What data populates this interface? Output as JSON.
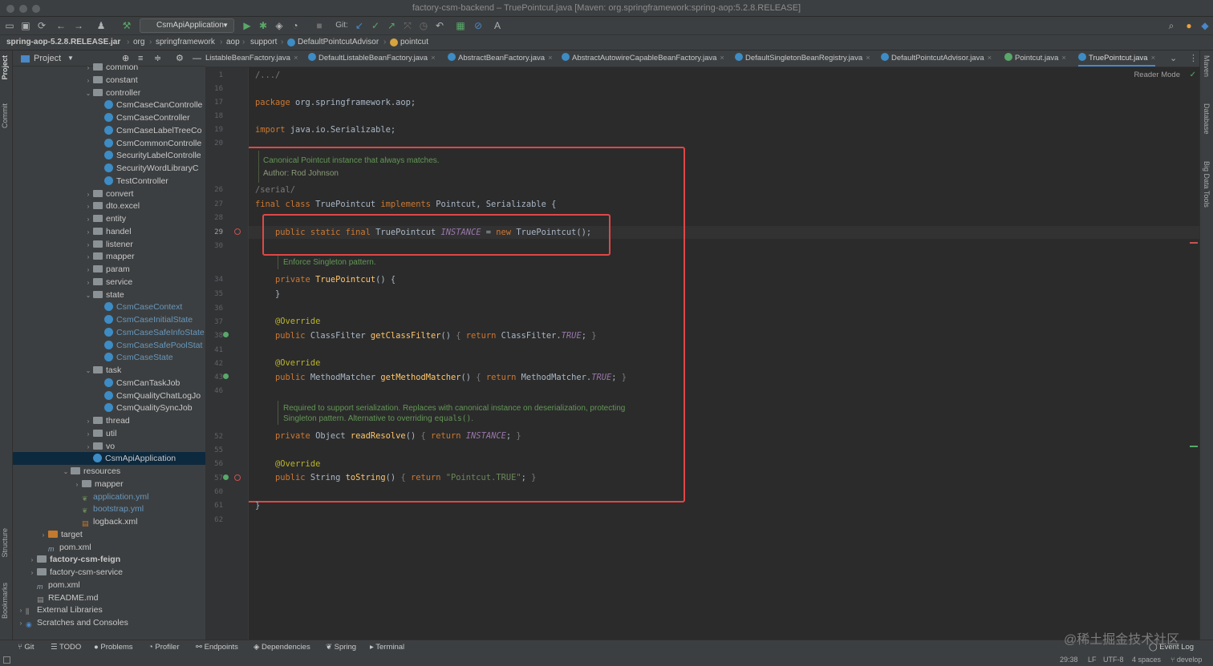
{
  "window": {
    "title": "factory-csm-backend – TruePointcut.java [Maven: org.springframework:spring-aop:5.2.8.RELEASE]"
  },
  "toolbar": {
    "run_config": "CsmApiApplication",
    "git_label": "Git:"
  },
  "breadcrumb": [
    "spring-aop-5.2.8.RELEASE.jar",
    "org",
    "springframework",
    "aop",
    "support",
    "DefaultPointcutAdvisor",
    "pointcut"
  ],
  "left_strip": [
    "Project",
    "Commit",
    "Structure",
    "Bookmarks"
  ],
  "right_strip": [
    "Maven",
    "Database",
    "Big Data Tools"
  ],
  "project_panel": {
    "title": "Project",
    "tree": [
      {
        "label": "common",
        "type": "folder",
        "depth": 6,
        "arrow": "›"
      },
      {
        "label": "constant",
        "type": "folder",
        "depth": 6,
        "arrow": "›"
      },
      {
        "label": "controller",
        "type": "folder",
        "depth": 6,
        "arrow": "⌄"
      },
      {
        "label": "CsmCaseCanControlle",
        "type": "class",
        "depth": 7
      },
      {
        "label": "CsmCaseController",
        "type": "class",
        "depth": 7
      },
      {
        "label": "CsmCaseLabelTreeCo",
        "type": "class",
        "depth": 7
      },
      {
        "label": "CsmCommonControlle",
        "type": "class",
        "depth": 7
      },
      {
        "label": "SecurityLabelControlle",
        "type": "class",
        "depth": 7
      },
      {
        "label": "SecurityWordLibraryC",
        "type": "class",
        "depth": 7
      },
      {
        "label": "TestController",
        "type": "class",
        "depth": 7
      },
      {
        "label": "convert",
        "type": "folder",
        "depth": 6,
        "arrow": "›"
      },
      {
        "label": "dto.excel",
        "type": "folder",
        "depth": 6,
        "arrow": "›"
      },
      {
        "label": "entity",
        "type": "folder",
        "depth": 6,
        "arrow": "›"
      },
      {
        "label": "handel",
        "type": "folder",
        "depth": 6,
        "arrow": "›"
      },
      {
        "label": "listener",
        "type": "folder",
        "depth": 6,
        "arrow": "›"
      },
      {
        "label": "mapper",
        "type": "folder",
        "depth": 6,
        "arrow": "›"
      },
      {
        "label": "param",
        "type": "folder",
        "depth": 6,
        "arrow": "›"
      },
      {
        "label": "service",
        "type": "folder",
        "depth": 6,
        "arrow": "›"
      },
      {
        "label": "state",
        "type": "folder",
        "depth": 6,
        "arrow": "⌄"
      },
      {
        "label": "CsmCaseContext",
        "type": "class-blue",
        "depth": 7
      },
      {
        "label": "CsmCaseInitialState",
        "type": "class-blue",
        "depth": 7
      },
      {
        "label": "CsmCaseSafeInfoState",
        "type": "class-blue",
        "depth": 7
      },
      {
        "label": "CsmCaseSafePoolStat",
        "type": "class-blue",
        "depth": 7
      },
      {
        "label": "CsmCaseState",
        "type": "class-blue",
        "depth": 7
      },
      {
        "label": "task",
        "type": "folder",
        "depth": 6,
        "arrow": "⌄"
      },
      {
        "label": "CsmCanTaskJob",
        "type": "class",
        "depth": 7
      },
      {
        "label": "CsmQualityChatLogJo",
        "type": "class",
        "depth": 7
      },
      {
        "label": "CsmQualitySyncJob",
        "type": "class",
        "depth": 7
      },
      {
        "label": "thread",
        "type": "folder",
        "depth": 6,
        "arrow": "›"
      },
      {
        "label": "util",
        "type": "folder",
        "depth": 6,
        "arrow": "›"
      },
      {
        "label": "vo",
        "type": "folder",
        "depth": 6,
        "arrow": "›"
      },
      {
        "label": "CsmApiApplication",
        "type": "class",
        "depth": 6,
        "selected": true
      },
      {
        "label": "resources",
        "type": "folder",
        "depth": 4,
        "arrow": "⌄"
      },
      {
        "label": "mapper",
        "type": "folder",
        "depth": 5,
        "arrow": "›"
      },
      {
        "label": "application.yml",
        "type": "yml",
        "depth": 5
      },
      {
        "label": "bootstrap.yml",
        "type": "yml",
        "depth": 5
      },
      {
        "label": "logback.xml",
        "type": "xml",
        "depth": 5
      },
      {
        "label": "target",
        "type": "folder-orange",
        "depth": 2,
        "arrow": "›"
      },
      {
        "label": "pom.xml",
        "type": "maven",
        "depth": 2
      },
      {
        "label": "factory-csm-feign",
        "type": "folder",
        "depth": 1,
        "arrow": "›",
        "bold": true
      },
      {
        "label": "factory-csm-service",
        "type": "folder",
        "depth": 1,
        "arrow": "›"
      },
      {
        "label": "pom.xml",
        "type": "maven",
        "depth": 1
      },
      {
        "label": "README.md",
        "type": "md",
        "depth": 1
      },
      {
        "label": "External Libraries",
        "type": "lib",
        "depth": 0,
        "arrow": "›"
      },
      {
        "label": "Scratches and Consoles",
        "type": "scratch",
        "depth": 0,
        "arrow": "›"
      }
    ]
  },
  "tabs": [
    {
      "label": "ListableBeanFactory.java"
    },
    {
      "label": "DefaultListableBeanFactory.java"
    },
    {
      "label": "AbstractBeanFactory.java"
    },
    {
      "label": "AbstractAutowireCapableBeanFactory.java"
    },
    {
      "label": "DefaultSingletonBeanRegistry.java"
    },
    {
      "label": "DefaultPointcutAdvisor.java"
    },
    {
      "label": "Pointcut.java"
    },
    {
      "label": "TruePointcut.java",
      "active": true
    }
  ],
  "editor": {
    "reader_mode": "Reader Mode",
    "line_numbers": [
      "1",
      "16",
      "17",
      "18",
      "19",
      "20",
      "26",
      "27",
      "28",
      "29",
      "30",
      "34",
      "35",
      "36",
      "37",
      "38",
      "41",
      "42",
      "43",
      "46",
      "52",
      "55",
      "56",
      "57",
      "60",
      "61",
      "62"
    ],
    "code_lines": [
      {
        "parts": [
          {
            "t": "/.../",
            "c": "br"
          }
        ]
      },
      {
        "parts": [
          {
            "t": "package ",
            "c": "kw"
          },
          {
            "t": "org.springframework.aop;",
            "c": ""
          }
        ]
      },
      {
        "parts": [
          {
            "t": "import ",
            "c": "kw"
          },
          {
            "t": "java.io.Serializable;",
            "c": ""
          }
        ]
      },
      {
        "parts": [
          {
            "t": "/serial/",
            "c": "br"
          }
        ]
      },
      {
        "parts": [
          {
            "t": "final class ",
            "c": "kw"
          },
          {
            "t": "TruePointcut ",
            "c": ""
          },
          {
            "t": "implements ",
            "c": "kw"
          },
          {
            "t": "Pointcut, Serializable {",
            "c": ""
          }
        ]
      },
      {
        "parts": [
          {
            "t": "    public static final ",
            "c": "kw"
          },
          {
            "t": "TruePointcut ",
            "c": ""
          },
          {
            "t": "INSTANCE",
            "c": "it"
          },
          {
            "t": " = ",
            "c": ""
          },
          {
            "t": "new ",
            "c": "kw"
          },
          {
            "t": "TruePointcut();",
            "c": ""
          }
        ]
      },
      {
        "parts": [
          {
            "t": "    private ",
            "c": "kw"
          },
          {
            "t": "TruePointcut",
            "c": "fn"
          },
          {
            "t": "() {",
            "c": ""
          }
        ]
      },
      {
        "parts": [
          {
            "t": "    }",
            "c": ""
          }
        ]
      },
      {
        "parts": [
          {
            "t": "    @Override",
            "c": "an"
          }
        ]
      },
      {
        "parts": [
          {
            "t": "    public ",
            "c": "kw"
          },
          {
            "t": "ClassFilter ",
            "c": ""
          },
          {
            "t": "getClassFilter",
            "c": "fn"
          },
          {
            "t": "() ",
            "c": ""
          },
          {
            "t": "{ ",
            "c": "br"
          },
          {
            "t": "return ",
            "c": "kw"
          },
          {
            "t": "ClassFilter.",
            "c": ""
          },
          {
            "t": "TRUE",
            "c": "it"
          },
          {
            "t": "; ",
            "c": ""
          },
          {
            "t": "}",
            "c": "br"
          }
        ]
      },
      {
        "parts": [
          {
            "t": "    @Override",
            "c": "an"
          }
        ]
      },
      {
        "parts": [
          {
            "t": "    public ",
            "c": "kw"
          },
          {
            "t": "MethodMatcher ",
            "c": ""
          },
          {
            "t": "getMethodMatcher",
            "c": "fn"
          },
          {
            "t": "() ",
            "c": ""
          },
          {
            "t": "{ ",
            "c": "br"
          },
          {
            "t": "return ",
            "c": "kw"
          },
          {
            "t": "MethodMatcher.",
            "c": ""
          },
          {
            "t": "TRUE",
            "c": "it"
          },
          {
            "t": "; ",
            "c": ""
          },
          {
            "t": "}",
            "c": "br"
          }
        ]
      },
      {
        "parts": [
          {
            "t": "    private ",
            "c": "kw"
          },
          {
            "t": "Object ",
            "c": ""
          },
          {
            "t": "readResolve",
            "c": "fn"
          },
          {
            "t": "() ",
            "c": ""
          },
          {
            "t": "{ ",
            "c": "br"
          },
          {
            "t": "return ",
            "c": "kw"
          },
          {
            "t": "INSTANCE",
            "c": "it"
          },
          {
            "t": "; ",
            "c": ""
          },
          {
            "t": "}",
            "c": "br"
          }
        ]
      },
      {
        "parts": [
          {
            "t": "    @Override",
            "c": "an"
          }
        ]
      },
      {
        "parts": [
          {
            "t": "    public ",
            "c": "kw"
          },
          {
            "t": "String ",
            "c": ""
          },
          {
            "t": "toString",
            "c": "fn"
          },
          {
            "t": "() ",
            "c": ""
          },
          {
            "t": "{ ",
            "c": "br"
          },
          {
            "t": "return ",
            "c": "kw"
          },
          {
            "t": "\"Pointcut.TRUE\"",
            "c": "st"
          },
          {
            "t": "; ",
            "c": ""
          },
          {
            "t": "}",
            "c": "br"
          }
        ]
      },
      {
        "parts": [
          {
            "t": "}",
            "c": ""
          }
        ]
      }
    ],
    "docs": {
      "class_doc_1": "Canonical Pointcut instance that always matches.",
      "class_doc_2": "Author:  Rod Johnson",
      "ctor_doc": "Enforce Singleton pattern.",
      "resolve_doc_1": "Required to support serialization. Replaces with canonical instance on deserialization, protecting",
      "resolve_doc_2a": "Singleton pattern. Alternative to overriding ",
      "resolve_doc_2b": "equals()",
      "resolve_doc_2c": "."
    }
  },
  "bottom_tools": [
    "Git",
    "TODO",
    "Problems",
    "Profiler",
    "Endpoints",
    "Dependencies",
    "Spring",
    "Terminal"
  ],
  "status": {
    "event_log": "Event Log",
    "position": "29:38",
    "line_sep": "LF",
    "encoding": "UTF-8",
    "indent": "4 spaces",
    "branch": "develop"
  },
  "watermark": "@稀土掘金技术社区",
  "colors": {
    "accent": "#4a88c7",
    "highlight_box": "#e04747",
    "keyword": "#cc7832",
    "doc_comment": "#629755"
  }
}
